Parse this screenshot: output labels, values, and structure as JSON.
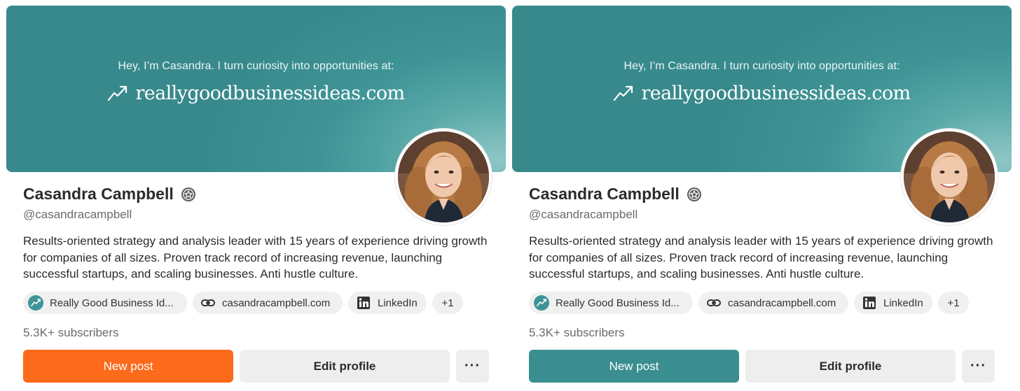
{
  "colors": {
    "banner_teal": "#3f9496",
    "new_post_orange": "#fd6a1c",
    "new_post_teal": "#3a8e90"
  },
  "profiles": [
    {
      "variant": "orange-button",
      "banner": {
        "tagline": "Hey, I’m Casandra. I turn curiosity into opportunities at:",
        "site": "reallygoodbusinessideas.com"
      },
      "name": "Casandra Campbell",
      "handle": "@casandracampbell",
      "bio": "Results-oriented strategy and analysis leader with 15 years of experience driving growth for companies of all sizes. Proven track record of increasing revenue, launching successful startups, and scaling businesses. Anti hustle culture.",
      "links": [
        "Really Good Business Id...",
        "casandracampbell.com",
        "LinkedIn",
        "+1"
      ],
      "subscribers": "5.3K+ subscribers",
      "buttons": {
        "new_post": "New post",
        "edit_profile": "Edit profile",
        "more": "···"
      }
    },
    {
      "variant": "teal-button",
      "banner": {
        "tagline": "Hey, I’m Casandra. I turn curiosity into opportunities at:",
        "site": "reallygoodbusinessideas.com"
      },
      "name": "Casandra Campbell",
      "handle": "@casandracampbell",
      "bio": "Results-oriented strategy and analysis leader with 15 years of experience driving growth for companies of all sizes. Proven track record of increasing revenue, launching successful startups, and scaling businesses. Anti hustle culture.",
      "links": [
        "Really Good Business Id...",
        "casandracampbell.com",
        "LinkedIn",
        "+1"
      ],
      "subscribers": "5.3K+ subscribers",
      "buttons": {
        "new_post": "New post",
        "edit_profile": "Edit profile",
        "more": "···"
      }
    }
  ]
}
